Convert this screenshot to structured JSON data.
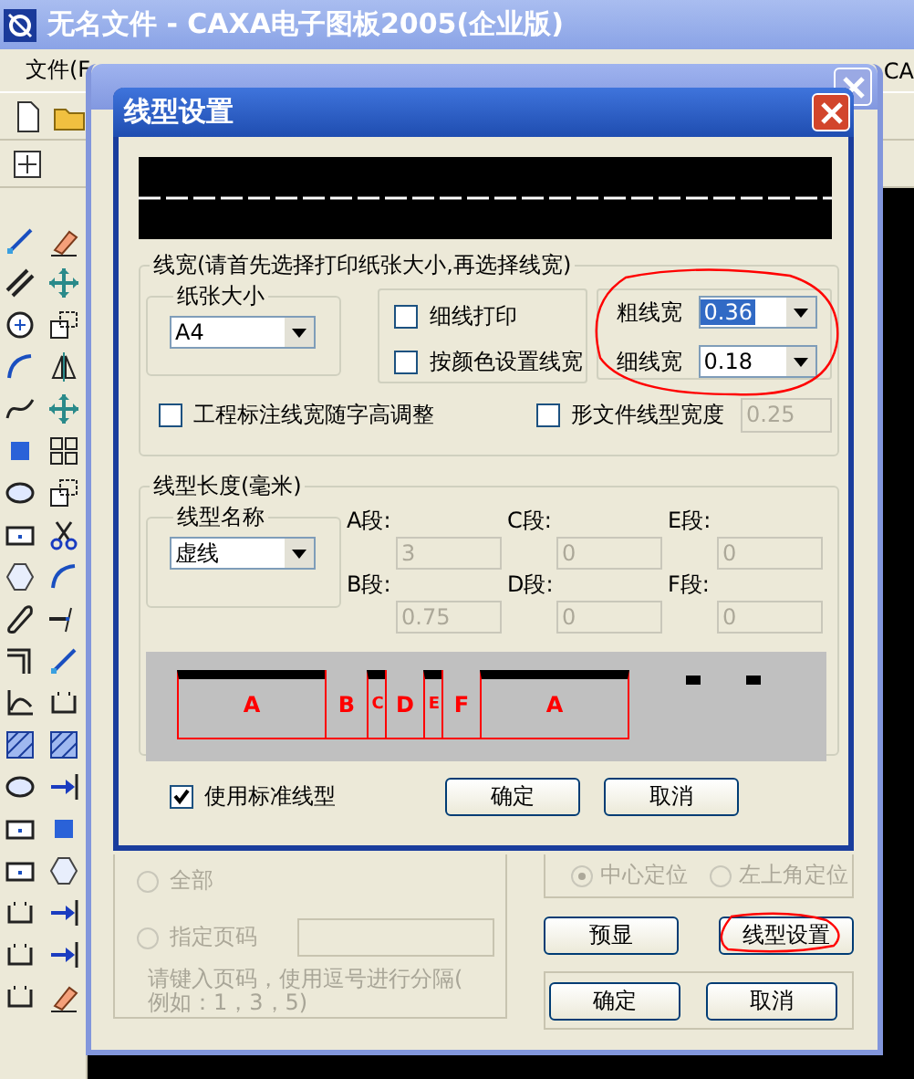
{
  "app": {
    "title": "无名文件 - CAXA电子图板2005(企业版)",
    "menu": [
      "文件(F",
      "CA"
    ]
  },
  "print_dialog": {
    "page_options": [
      {
        "label": "全部",
        "selected": false,
        "disabled": true
      },
      {
        "label": "指定页码",
        "selected": false,
        "disabled": true
      }
    ],
    "hint": [
      "请键入页码，使用逗号进行分隔(",
      "例如：1，3，5)"
    ],
    "position_options": [
      {
        "label": "中心定位",
        "selected": true,
        "disabled": true
      },
      {
        "label": "左上角定位",
        "selected": false,
        "disabled": true
      }
    ],
    "buttons": [
      "预显",
      "线型设置"
    ],
    "footer_buttons": [
      "确定",
      "取消"
    ]
  },
  "line_dialog": {
    "title": "线型设置",
    "width_group": {
      "legend": "线宽(请首先选择打印纸张大小,再选择线宽)",
      "paper": {
        "legend": "纸张大小",
        "value": "A4"
      },
      "options": [
        {
          "label": "细线打印",
          "checked": false
        },
        {
          "label": "按颜色设置线宽",
          "checked": false
        }
      ],
      "widths": [
        {
          "label": "粗线宽",
          "value": "0.36",
          "highlighted": true
        },
        {
          "label": "细线宽",
          "value": "0.18",
          "highlighted": false
        }
      ],
      "scale_with_text": {
        "label": "工程标注线宽随字高调整",
        "checked": false
      },
      "shape_width": {
        "label": "形文件线型宽度",
        "checked": false,
        "value": "0.25"
      }
    },
    "length_group": {
      "legend": "线型长度(毫米)",
      "name": {
        "legend": "线型名称",
        "value": "虚线"
      },
      "segments": [
        {
          "label": "A段:",
          "value": "3"
        },
        {
          "label": "C段:",
          "value": "0"
        },
        {
          "label": "E段:",
          "value": "0"
        },
        {
          "label": "B段:",
          "value": "0.75"
        },
        {
          "label": "D段:",
          "value": "0"
        },
        {
          "label": "F段:",
          "value": "0"
        }
      ],
      "preview": [
        {
          "label": "A",
          "kind": "dash"
        },
        {
          "label": "B",
          "kind": "gap"
        },
        {
          "label": "C",
          "kind": "dash"
        },
        {
          "label": "D",
          "kind": "gap"
        },
        {
          "label": "E",
          "kind": "dash"
        },
        {
          "label": "F",
          "kind": "gap"
        },
        {
          "label": "A",
          "kind": "dash"
        }
      ]
    },
    "standard": {
      "label": "使用标准线型",
      "checked": true
    },
    "buttons": [
      "确定",
      "取消"
    ]
  }
}
